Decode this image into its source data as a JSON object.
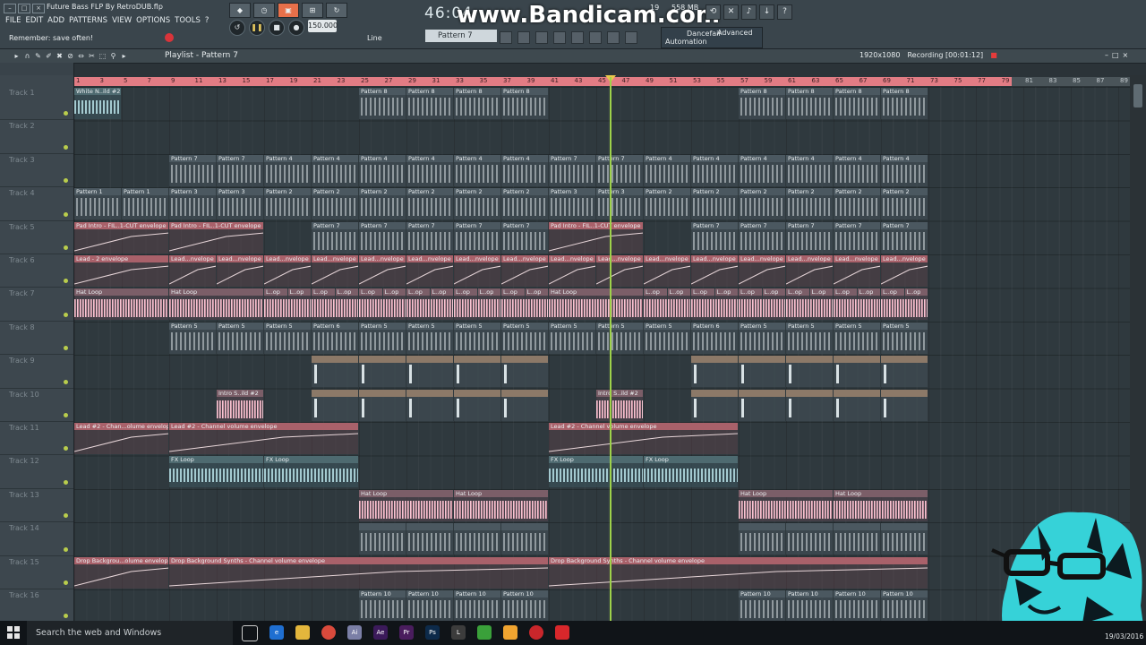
{
  "window": {
    "title": "Future Bass FLP By RetroDUB.flp",
    "controls": [
      "–",
      "□",
      "×"
    ]
  },
  "menu": [
    "FILE",
    "EDIT",
    "ADD",
    "PATTERNS",
    "VIEW",
    "OPTIONS",
    "TOOLS",
    "?"
  ],
  "hint": "Remember: save often!",
  "transport": {
    "bpm": "150.000",
    "time": "46:04",
    "snap": "Line",
    "pattern": "Pattern 7",
    "cpu_value": "19",
    "memory": "558 MB"
  },
  "watermark": "www.Bandicam.com",
  "automation_panel": {
    "label1": "Dancefair",
    "label2": "Advanced",
    "label3": "Automation"
  },
  "playlist": {
    "title": "Playlist - Pattern 7",
    "resolution": "1920x1080",
    "recording": "Recording [00:01:12]"
  },
  "ruler": [
    "1",
    "3",
    "5",
    "7",
    "9",
    "11",
    "13",
    "15",
    "17",
    "19",
    "21",
    "23",
    "25",
    "27",
    "29",
    "31",
    "33",
    "35",
    "37",
    "39",
    "41",
    "43",
    "45",
    "47",
    "49",
    "51",
    "53",
    "55",
    "57",
    "59",
    "61",
    "63",
    "65",
    "67",
    "69",
    "71",
    "73",
    "75",
    "77",
    "79",
    "81",
    "83",
    "85",
    "87",
    "89"
  ],
  "tracks": [
    "Track 1",
    "Track 2",
    "Track 3",
    "Track 4",
    "Track 5",
    "Track 6",
    "Track 7",
    "Track 8",
    "Track 9",
    "Track 10",
    "Track 11",
    "Track 12",
    "Track 13",
    "Track 14",
    "Track 15",
    "Track 16"
  ],
  "clips": {
    "white_n": "White N..ild #2",
    "pattern_8": "Pattern 8",
    "pattern_7": "Pattern 7",
    "pattern_4": "Pattern 4",
    "pattern_1": "Pattern 1",
    "pattern_3": "Pattern 3",
    "pattern_2": "Pattern 2",
    "pad_intro": "Pad Intro - FIL..1-CUT envelope",
    "lead_2_env": "Lead - 2 envelope",
    "lead_short": "Lead...nvelope",
    "hat_loop": "Hat Loop",
    "loop_short": "L..op",
    "pattern_5": "Pattern 5",
    "pattern_6": "Pattern 6",
    "intro_s": "Intro S..ild #2",
    "lead2_chan": "Lead #2 - Chan...olume envelope",
    "lead2_full": "Lead #2 - Channel volume envelope",
    "fx_loop": "FX Loop",
    "drop_short": "Drop Backgrou...olume envelope",
    "drop_full": "Drop Background Synths - Channel volume envelope",
    "pattern_10": "Pattern 10"
  },
  "taskbar": {
    "search": "Search the web and Windows",
    "date": "19/03/2016"
  }
}
